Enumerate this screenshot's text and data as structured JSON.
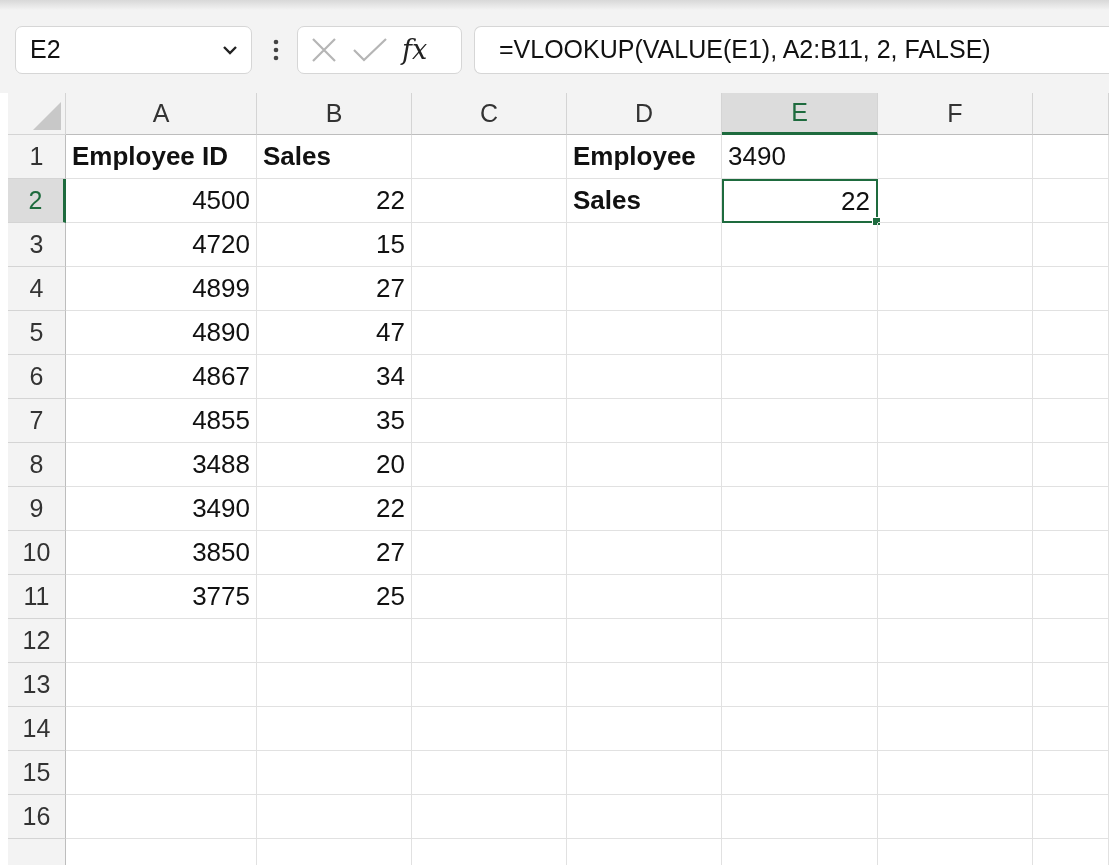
{
  "formula_bar": {
    "name_box": "E2",
    "fx": "fx",
    "formula": "=VLOOKUP(VALUE(E1), A2:B11, 2, FALSE)"
  },
  "columns": [
    {
      "label": "A",
      "selected": false
    },
    {
      "label": "B",
      "selected": false
    },
    {
      "label": "C",
      "selected": false
    },
    {
      "label": "D",
      "selected": false
    },
    {
      "label": "E",
      "selected": true
    },
    {
      "label": "F",
      "selected": false
    },
    {
      "selected": false
    }
  ],
  "rows": [
    {
      "number": "1",
      "selected": false,
      "cells": [
        {
          "text": "Employee ID",
          "kind": "text",
          "bold": true
        },
        {
          "text": "Sales",
          "kind": "text",
          "bold": true
        },
        {},
        {
          "text": "Employee",
          "kind": "text",
          "bold": true
        },
        {
          "text": "3490",
          "kind": "text",
          "bold": false
        },
        {},
        {}
      ]
    },
    {
      "number": "2",
      "selected": true,
      "cells": [
        {
          "text": "4500",
          "kind": "number"
        },
        {
          "text": "22",
          "kind": "number"
        },
        {},
        {
          "text": "Sales",
          "kind": "text",
          "bold": true
        },
        {
          "text": "22",
          "kind": "number",
          "active": true
        },
        {},
        {}
      ]
    },
    {
      "number": "3",
      "selected": false,
      "cells": [
        {
          "text": "4720",
          "kind": "number"
        },
        {
          "text": "15",
          "kind": "number"
        },
        {},
        {},
        {},
        {},
        {}
      ]
    },
    {
      "number": "4",
      "selected": false,
      "cells": [
        {
          "text": "4899",
          "kind": "number"
        },
        {
          "text": "27",
          "kind": "number"
        },
        {},
        {},
        {},
        {},
        {}
      ]
    },
    {
      "number": "5",
      "selected": false,
      "cells": [
        {
          "text": "4890",
          "kind": "number"
        },
        {
          "text": "47",
          "kind": "number"
        },
        {},
        {},
        {},
        {},
        {}
      ]
    },
    {
      "number": "6",
      "selected": false,
      "cells": [
        {
          "text": "4867",
          "kind": "number"
        },
        {
          "text": "34",
          "kind": "number"
        },
        {},
        {},
        {},
        {},
        {}
      ]
    },
    {
      "number": "7",
      "selected": false,
      "cells": [
        {
          "text": "4855",
          "kind": "number"
        },
        {
          "text": "35",
          "kind": "number"
        },
        {},
        {},
        {},
        {},
        {}
      ]
    },
    {
      "number": "8",
      "selected": false,
      "cells": [
        {
          "text": "3488",
          "kind": "number"
        },
        {
          "text": "20",
          "kind": "number"
        },
        {},
        {},
        {},
        {},
        {}
      ]
    },
    {
      "number": "9",
      "selected": false,
      "cells": [
        {
          "text": "3490",
          "kind": "number"
        },
        {
          "text": "22",
          "kind": "number"
        },
        {},
        {},
        {},
        {},
        {}
      ]
    },
    {
      "number": "10",
      "selected": false,
      "cells": [
        {
          "text": "3850",
          "kind": "number"
        },
        {
          "text": "27",
          "kind": "number"
        },
        {},
        {},
        {},
        {},
        {}
      ]
    },
    {
      "number": "11",
      "selected": false,
      "cells": [
        {
          "text": "3775",
          "kind": "number"
        },
        {
          "text": "25",
          "kind": "number"
        },
        {},
        {},
        {},
        {},
        {}
      ]
    },
    {
      "number": "12",
      "selected": false,
      "cells": [
        {},
        {},
        {},
        {},
        {},
        {},
        {}
      ]
    },
    {
      "number": "13",
      "selected": false,
      "cells": [
        {},
        {},
        {},
        {},
        {},
        {},
        {}
      ]
    },
    {
      "number": "14",
      "selected": false,
      "cells": [
        {},
        {},
        {},
        {},
        {},
        {},
        {}
      ]
    },
    {
      "number": "15",
      "selected": false,
      "cells": [
        {},
        {},
        {},
        {},
        {},
        {},
        {}
      ]
    },
    {
      "number": "16",
      "selected": false,
      "cells": [
        {},
        {},
        {},
        {},
        {},
        {},
        {}
      ]
    },
    {
      "selected": false,
      "cells": [
        {},
        {},
        {},
        {},
        {},
        {},
        {}
      ]
    }
  ]
}
